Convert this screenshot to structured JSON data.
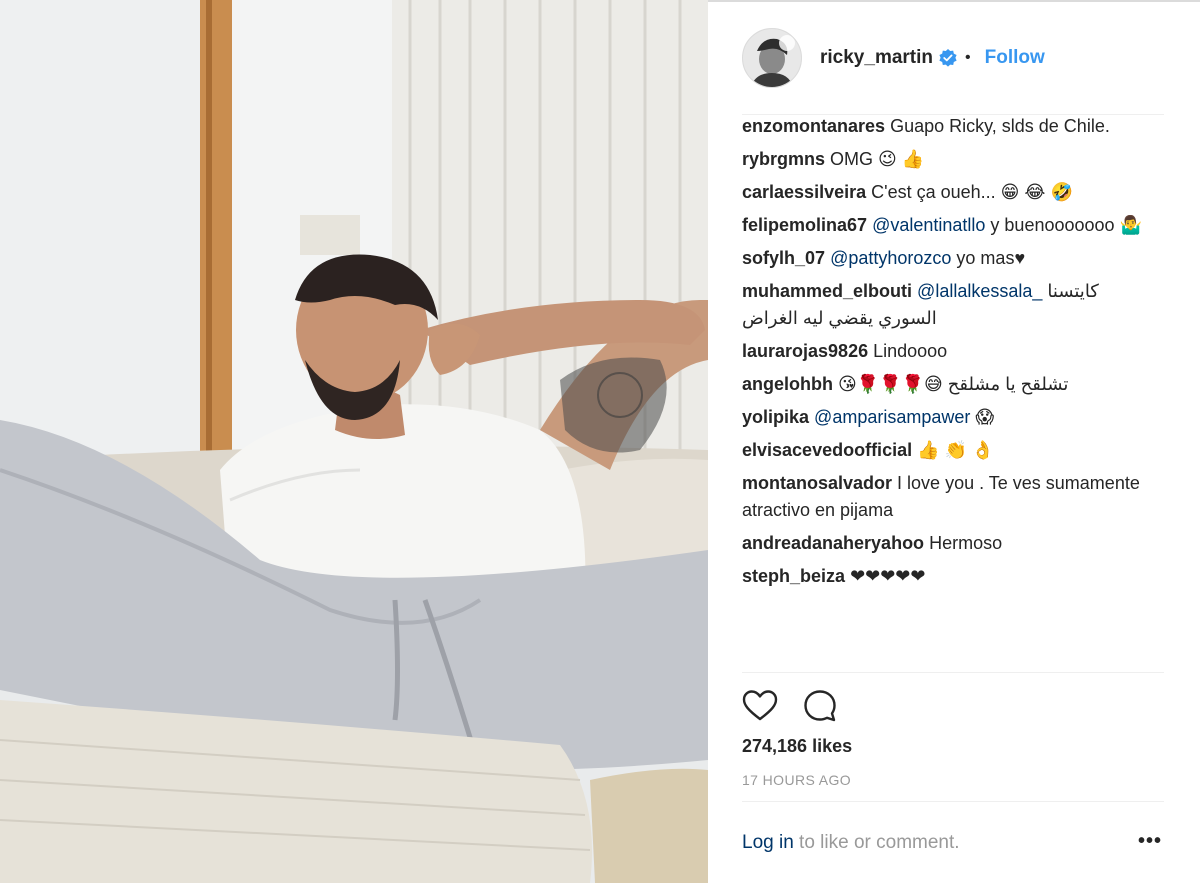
{
  "header": {
    "username": "ricky_martin",
    "separator": "•",
    "follow_label": "Follow"
  },
  "comments": [
    {
      "user": "enzomontanares",
      "text": "Guapo Ricky, slds de Chile."
    },
    {
      "user": "rybrgmns",
      "text": "OMG 😉 👍"
    },
    {
      "user": "carlaessilveira",
      "text": "C'est ça oueh... 😁 😂 🤣"
    },
    {
      "user": "felipemolina67",
      "mention": "@valentinatllo",
      "text": "y buenooooooo 🤷‍♂"
    },
    {
      "user": "sofylh_07",
      "mention": "@pattyhorozco",
      "text": "yo mas♥"
    },
    {
      "user": "muhammed_elbouti",
      "mention": "@lallalkessala_",
      "text": "كايتسنا السوري يقضي ليه الغراض"
    },
    {
      "user": "laurarojas9826",
      "text": "Lindoooo"
    },
    {
      "user": "angelohbh",
      "text": "تشلقح يا مشلقح 😅🌹🌹🌹😘"
    },
    {
      "user": "yolipika",
      "mention": "@amparisampawer",
      "text": "😱"
    },
    {
      "user": "elvisacevedoofficial",
      "text": "👍 👏 👌"
    },
    {
      "user": "montanosalvador",
      "text": "I love you . Te ves sumamente atractivo en pijama"
    },
    {
      "user": "andreadanaheryahoo",
      "text": "Hermoso"
    },
    {
      "user": "steph_beiza",
      "text": "❤❤❤❤❤"
    }
  ],
  "actions": {
    "like_icon": "heart-icon",
    "comment_icon": "speech-bubble-icon"
  },
  "likes": "274,186 likes",
  "timestamp": "17 HOURS AGO",
  "footer": {
    "login_link": "Log in",
    "login_rest": " to like or comment.",
    "more_label": "•••"
  },
  "colors": {
    "link_blue": "#3897f0",
    "mention_blue": "#003569",
    "muted_gray": "#999999",
    "text": "#262626"
  }
}
